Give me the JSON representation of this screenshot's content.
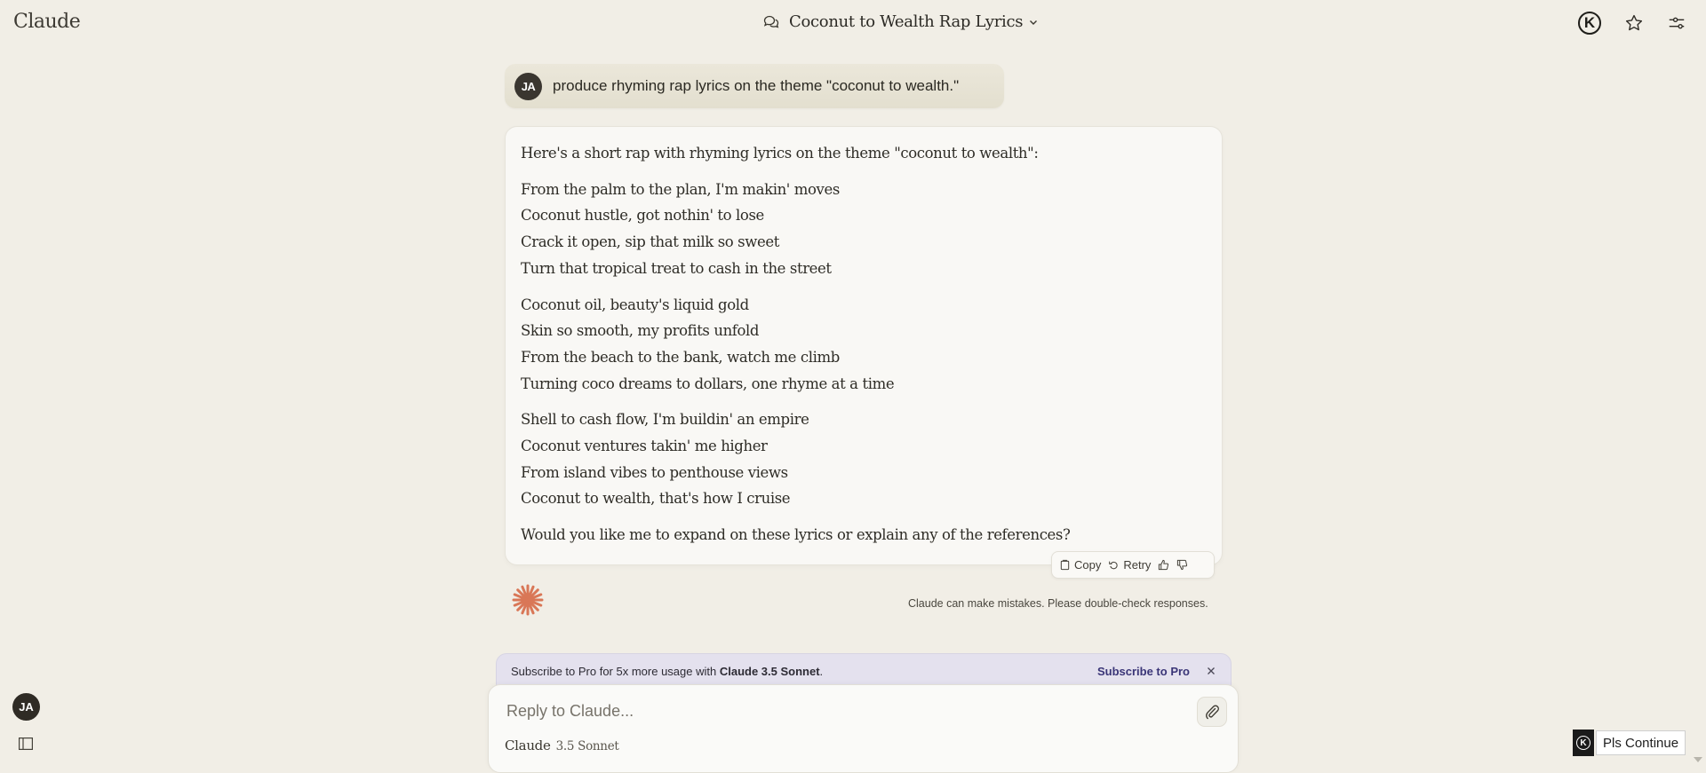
{
  "app": {
    "brand": "Claude"
  },
  "header": {
    "conversation_title": "Coconut to Wealth Rap Lyrics",
    "icons": {
      "chat": "chat-bubbles-icon",
      "dropdown": "chevron-down-icon",
      "extension": "k-logo-icon",
      "star": "star-icon",
      "settings": "sliders-icon"
    },
    "extension_letter": "K"
  },
  "conversation": {
    "user_message": {
      "avatar_initials": "JA",
      "text": "produce rhyming rap lyrics on the theme \"coconut to wealth.\""
    },
    "assistant_message": {
      "intro": "Here's a short rap with rhyming lyrics on the theme \"coconut to wealth\":",
      "stanzas": [
        [
          "From the palm to the plan, I'm makin' moves",
          "Coconut hustle, got nothin' to lose",
          "Crack it open, sip that milk so sweet",
          "Turn that tropical treat to cash in the street"
        ],
        [
          "Coconut oil, beauty's liquid gold",
          "Skin so smooth, my profits unfold",
          "From the beach to the bank, watch me climb",
          "Turning coco dreams to dollars, one rhyme at a time"
        ],
        [
          "Shell to cash flow, I'm buildin' an empire",
          "Coconut ventures takin' me higher",
          "From island vibes to penthouse views",
          "Coconut to wealth, that's how I cruise"
        ]
      ],
      "outro": "Would you like me to expand on these lyrics or explain any of the references?"
    },
    "actions": {
      "copy": "Copy",
      "retry": "Retry"
    },
    "disclaimer": "Claude can make mistakes. Please double-check responses."
  },
  "banner": {
    "text_prefix": "Subscribe to Pro for 5x more usage with ",
    "text_bold": "Claude 3.5 Sonnet",
    "text_suffix": ".",
    "cta": "Subscribe to Pro"
  },
  "composer": {
    "placeholder": "Reply to Claude...",
    "value": "",
    "model_name": "Claude",
    "model_version": "3.5 Sonnet"
  },
  "sidebar": {
    "avatar_initials": "JA"
  },
  "extension": {
    "logo_letter": "K",
    "button_label": "Pls Continue"
  },
  "colors": {
    "background": "#f1eee6",
    "accent_spark": "#d97757",
    "banner_bg": "#e4e1ee",
    "cta_text": "#3a3577"
  }
}
